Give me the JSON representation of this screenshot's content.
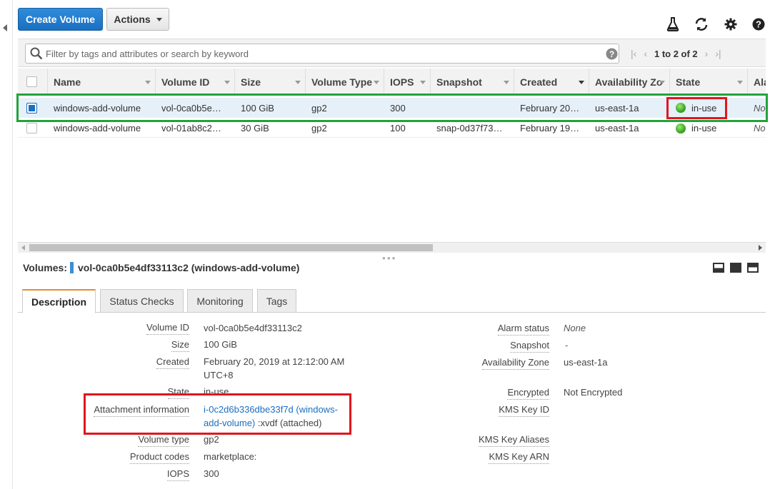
{
  "toolbar": {
    "create_label": "Create Volume",
    "actions_label": "Actions"
  },
  "filter": {
    "placeholder": "Filter by tags and attributes or search by keyword",
    "pager_text": "1 to 2 of 2"
  },
  "table": {
    "columns": [
      "Name",
      "Volume ID",
      "Size",
      "Volume Type",
      "IOPS",
      "Snapshot",
      "Created",
      "Availability Zo",
      "State",
      "Ala"
    ],
    "rows": [
      {
        "name": "windows-add-volume",
        "volume_id": "vol-0ca0b5e…",
        "size": "100 GiB",
        "type": "gp2",
        "iops": "300",
        "snapshot": "",
        "created": "February 20…",
        "az": "us-east-1a",
        "state": "in-use",
        "alarm": "No",
        "selected": true
      },
      {
        "name": "windows-add-volume",
        "volume_id": "vol-01ab8c2…",
        "size": "30 GiB",
        "type": "gp2",
        "iops": "100",
        "snapshot": "snap-0d37f73…",
        "created": "February 19…",
        "az": "us-east-1a",
        "state": "in-use",
        "alarm": "No",
        "selected": false
      }
    ]
  },
  "detail": {
    "prefix": "Volumes:",
    "title": "vol-0ca0b5e4df33113c2 (windows-add-volume)",
    "tabs": [
      "Description",
      "Status Checks",
      "Monitoring",
      "Tags"
    ],
    "left": {
      "volume_id_label": "Volume ID",
      "volume_id": "vol-0ca0b5e4df33113c2",
      "size_label": "Size",
      "size": "100 GiB",
      "created_label": "Created",
      "created_1": "February 20, 2019 at 12:12:00 AM",
      "created_2": "UTC+8",
      "state_label": "State",
      "state": "in-use",
      "attach_label": "Attachment information",
      "attach_link_1": "i-0c2d6b336dbe33f7d (windows-",
      "attach_link_2": "add-volume)",
      "attach_suffix": ":xvdf (attached)",
      "type_label": "Volume type",
      "type": "gp2",
      "codes_label": "Product codes",
      "codes": "marketplace:",
      "iops_label": "IOPS",
      "iops": "300"
    },
    "right": {
      "alarm_label": "Alarm status",
      "alarm": "None",
      "snapshot_label": "Snapshot",
      "snapshot": "-",
      "az_label": "Availability Zone",
      "az": "us-east-1a",
      "encrypted_label": "Encrypted",
      "encrypted": "Not Encrypted",
      "kms_id_label": "KMS Key ID",
      "kms_aliases_label": "KMS Key Aliases",
      "kms_arn_label": "KMS Key ARN"
    }
  },
  "colors": {
    "primary": "#1a6fc0",
    "highlight_green": "#22a33a",
    "highlight_red": "#e0161e",
    "tab_accent": "#e88b2f"
  }
}
